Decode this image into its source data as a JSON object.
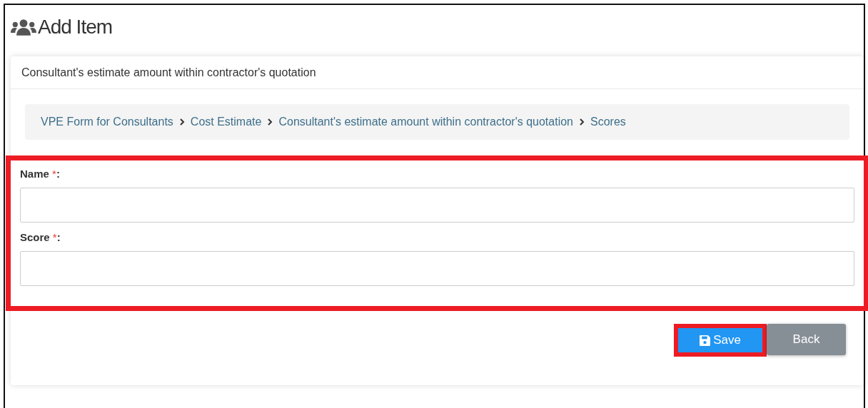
{
  "page": {
    "title": "Add Item"
  },
  "card": {
    "header": "Consultant's estimate amount within contractor's quotation"
  },
  "breadcrumb": [
    "VPE Form for Consultants",
    "Cost Estimate",
    "Consultant's estimate amount within contractor's quotation",
    "Scores"
  ],
  "fields": [
    {
      "label": "Name",
      "required_mark": "*",
      "suffix": ":"
    },
    {
      "label": "Score",
      "required_mark": "*",
      "suffix": ":"
    }
  ],
  "buttons": [
    {
      "kind": "primary",
      "label": "Save",
      "highlighted": true
    },
    {
      "kind": "secondary",
      "label": "Back",
      "highlighted": false
    }
  ]
}
